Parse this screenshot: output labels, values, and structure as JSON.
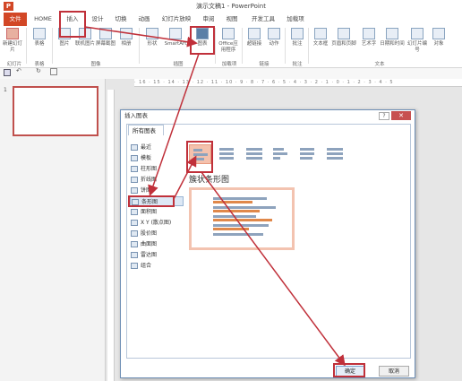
{
  "window": {
    "title": "演示文稿1 - PowerPoint",
    "logo": "P"
  },
  "tabs": [
    "文件",
    "HOME",
    "插入",
    "设计",
    "切换",
    "动画",
    "幻灯片放映",
    "审阅",
    "视图",
    "开发工具",
    "加载项"
  ],
  "ribbon": {
    "buttons": [
      "新建幻灯片",
      "表格",
      "图片",
      "联机图片",
      "屏幕截图",
      "相册",
      "形状",
      "SmartArt",
      "图表",
      "Office应用程序",
      "超链接",
      "动作",
      "批注",
      "文本框",
      "页眉和页脚",
      "艺术字",
      "日期和时间",
      "幻灯片编号",
      "对象"
    ],
    "groups": [
      "幻灯片",
      "表格",
      "图像",
      "插图",
      "加载项",
      "链接",
      "批注",
      "文本"
    ]
  },
  "thumbnails": {
    "slide_number": "1"
  },
  "ruler": {
    "marks": "· 16 · 15 · 14 · 13 · 12 · 11 · 10 · 9 · 8 · 7 · 6 · 5 · 4 · 3 · 2 · 1 · 0 · 1 · 2 · 3 · 4 · 5"
  },
  "dialog": {
    "title": "插入图表",
    "help": "?",
    "close": "✕",
    "tab": "所有图表",
    "categories": [
      "最近",
      "模板",
      "柱形图",
      "折线图",
      "饼图",
      "条形图",
      "面积图",
      "X Y (散点图)",
      "股价图",
      "曲面图",
      "雷达图",
      "组合"
    ],
    "selected_category": "条形图",
    "subtype_heading": "簇状条形图",
    "ok": "确定",
    "cancel": "取消"
  },
  "accent": "#c0303a",
  "brand": "#d24726"
}
